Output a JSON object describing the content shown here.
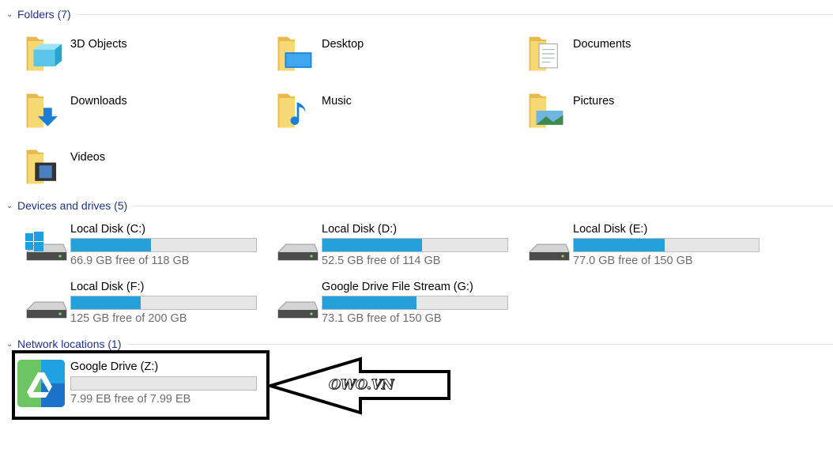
{
  "groups": {
    "folders": "Folders (7)",
    "devices": "Devices and drives (5)",
    "network": "Network locations (1)"
  },
  "folders": [
    {
      "label": "3D Objects",
      "icon": "3d-objects-icon"
    },
    {
      "label": "Desktop",
      "icon": "desktop-icon"
    },
    {
      "label": "Documents",
      "icon": "documents-icon"
    },
    {
      "label": "Downloads",
      "icon": "downloads-icon"
    },
    {
      "label": "Music",
      "icon": "music-icon"
    },
    {
      "label": "Pictures",
      "icon": "pictures-icon"
    },
    {
      "label": "Videos",
      "icon": "videos-icon"
    }
  ],
  "drives": [
    {
      "name": "Local Disk (C:)",
      "free": "66.9 GB free of 118 GB",
      "used_percent": 43,
      "windows": true
    },
    {
      "name": "Local Disk (D:)",
      "free": "52.5 GB free of 114 GB",
      "used_percent": 54
    },
    {
      "name": "Local Disk (E:)",
      "free": "77.0 GB free of 150 GB",
      "used_percent": 49
    },
    {
      "name": "Local Disk (F:)",
      "free": "125 GB free of 200 GB",
      "used_percent": 37.5
    },
    {
      "name": "Google Drive File Stream (G:)",
      "free": "73.1 GB free of 150 GB",
      "used_percent": 51
    }
  ],
  "network": [
    {
      "name": "Google Drive (Z:)",
      "free": "7.99 EB free of 7.99 EB",
      "used_percent": 0
    }
  ],
  "annotation": {
    "watermark": "OWO.VN"
  },
  "colors": {
    "bar": "#26a0da",
    "header": "#1e3287"
  }
}
